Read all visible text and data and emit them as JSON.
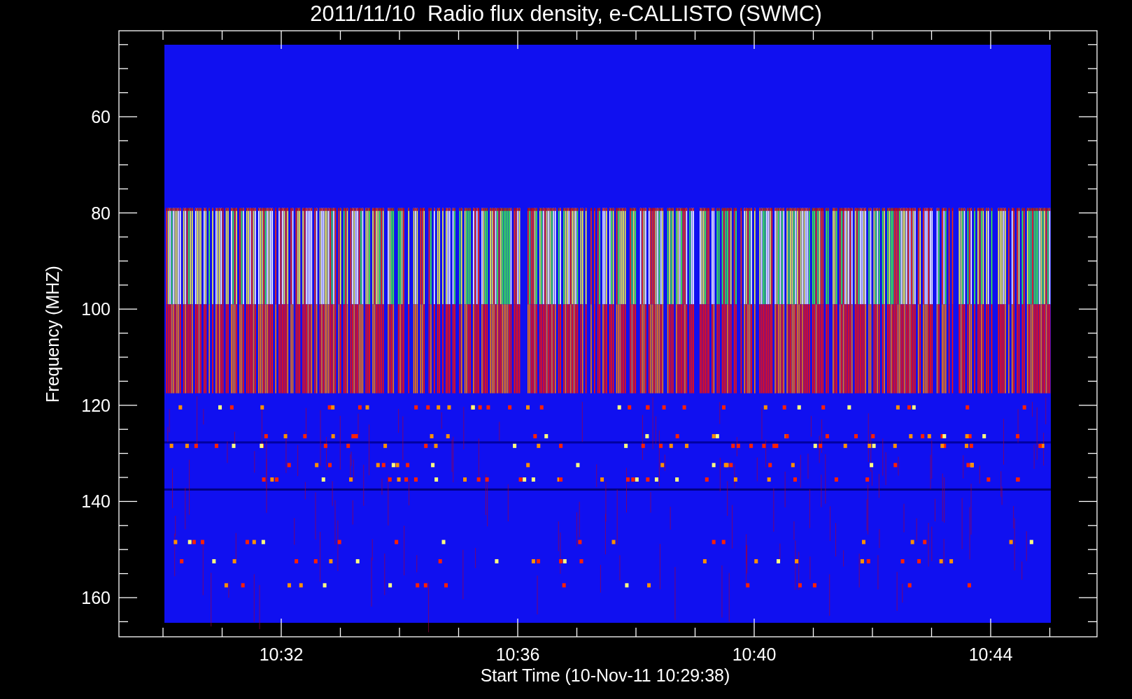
{
  "title": "2011/11/10  Radio flux density, e-CALLISTO (SWMC)",
  "y_axis": {
    "label": "Frequency (MHZ)",
    "ticks": [
      "60",
      "80",
      "100",
      "120",
      "140",
      "160"
    ]
  },
  "x_axis": {
    "label": "Start Time (10-Nov-11 10:29:38)",
    "ticks": [
      "10:32",
      "10:36",
      "10:40",
      "10:44"
    ]
  }
}
